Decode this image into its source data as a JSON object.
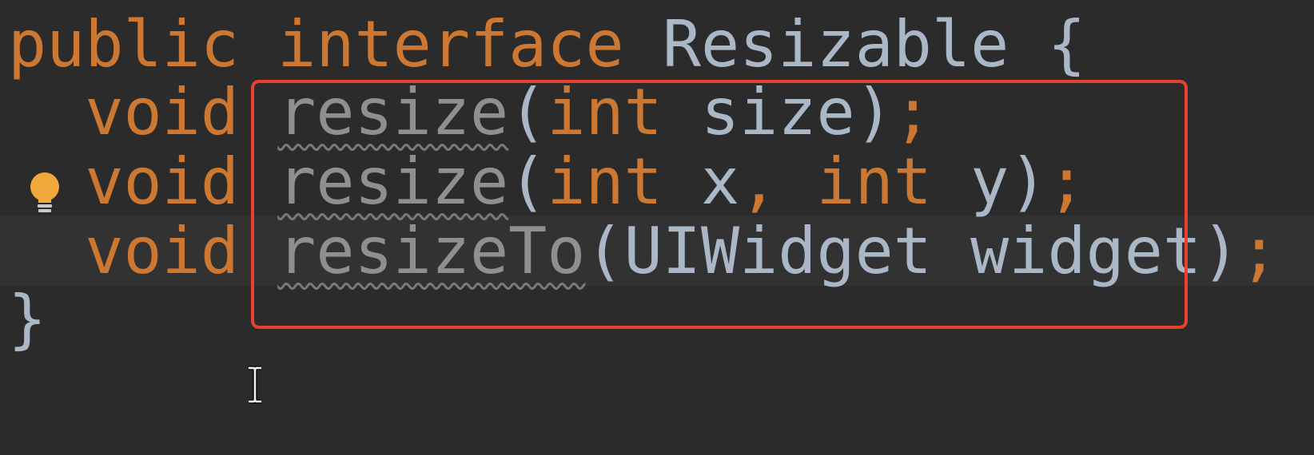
{
  "code": {
    "line1": {
      "kw_public": "public",
      "kw_interface": "interface",
      "name": "Resizable",
      "brace_open": "{"
    },
    "line2": {
      "kw_void": "void",
      "method": "resize",
      "paren_open": "(",
      "type": "int",
      "param": "size",
      "paren_close": ")",
      "semi": ";"
    },
    "line3": {
      "kw_void": "void",
      "method": "resize",
      "paren_open": "(",
      "type1": "int",
      "param1": "x",
      "comma": ",",
      "type2": "int",
      "param2": "y",
      "paren_close": ")",
      "semi": ";"
    },
    "line4": {
      "kw_void": "void",
      "method": "resizeTo",
      "paren_open": "(",
      "type": "UIWidget",
      "param": "widget",
      "paren_close": ")",
      "semi": ";"
    },
    "line5": {
      "brace_close": "}"
    }
  },
  "colors": {
    "background": "#2b2b2b",
    "current_line": "#323232",
    "keyword": "#cc7832",
    "identifier": "#a9b7c6",
    "unused_method": "#8f8f8f",
    "highlight_border": "#e8412f",
    "bulb": "#f2a93b"
  },
  "icons": {
    "intention_bulb": "lightbulb-icon",
    "text_cursor": "i-beam-cursor-icon"
  }
}
